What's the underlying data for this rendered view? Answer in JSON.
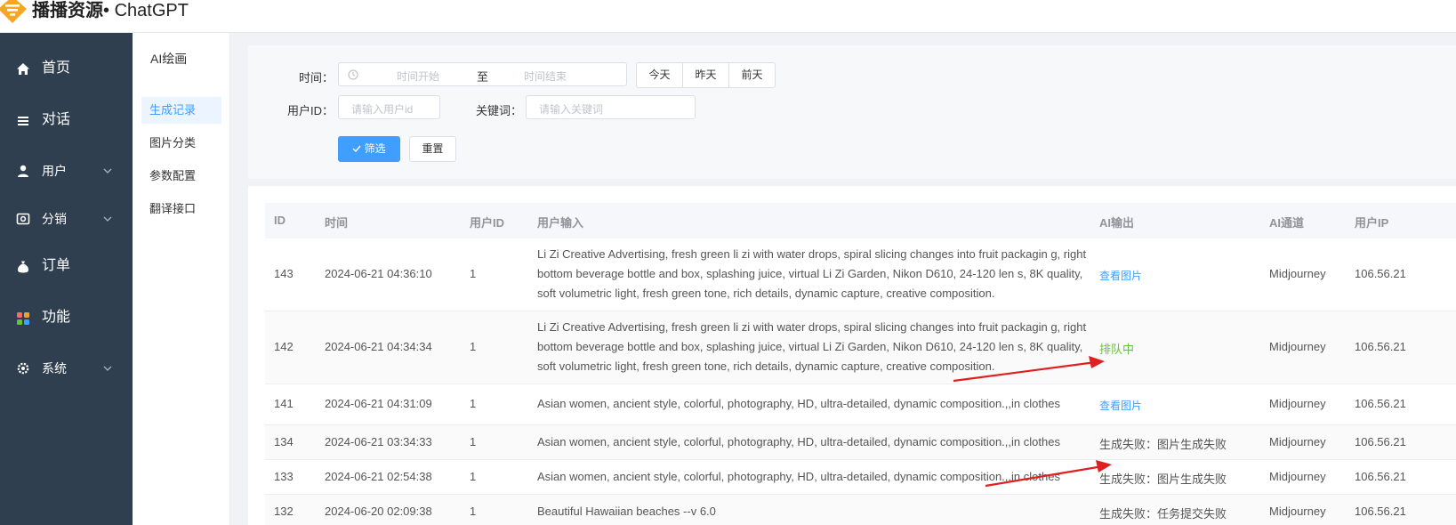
{
  "app": {
    "brand_cn": "播播资源",
    "brand_sep": "•",
    "brand_en": "ChatGPT"
  },
  "nav": {
    "items": [
      {
        "label": "首页",
        "icon": "home-icon"
      },
      {
        "label": "对话",
        "icon": "menu-icon"
      },
      {
        "label": "用户",
        "icon": "user-icon",
        "expandable": true
      },
      {
        "label": "分销",
        "icon": "distribution-icon",
        "expandable": true
      },
      {
        "label": "订单",
        "icon": "money-bag-icon"
      },
      {
        "label": "功能",
        "icon": "apps-grid-icon"
      },
      {
        "label": "系统",
        "icon": "gear-icon",
        "expandable": true
      }
    ]
  },
  "submenu": {
    "title": "AI绘画",
    "items": [
      "生成记录",
      "图片分类",
      "参数配置",
      "翻译接口"
    ],
    "active_index": 0
  },
  "filters": {
    "time_label": "时间：",
    "time_start_placeholder": "时间开始",
    "time_sep": "至",
    "time_end_placeholder": "时间结束",
    "quick_days": [
      "今天",
      "昨天",
      "前天"
    ],
    "user_id_label": "用户ID：",
    "user_id_placeholder": "请输入用户id",
    "keyword_label": "关键词：",
    "keyword_placeholder": "请输入关键词",
    "filter_button": "筛选",
    "reset_button": "重置"
  },
  "table": {
    "columns": [
      "ID",
      "时间",
      "用户ID",
      "用户输入",
      "AI输出",
      "AI通道",
      "用户IP"
    ],
    "rows": [
      {
        "id": "143",
        "time": "2024-06-21 04:36:10",
        "user_id": "1",
        "input": "Li Zi Creative Advertising, fresh green li zi with water drops, spiral slicing changes into fruit packagin g, right bottom beverage bottle and box, splashing juice, virtual Li Zi Garden, Nikon D610, 24-120 len s, 8K quality, soft volumetric light, fresh green tone, rich details, dynamic capture, creative composition.",
        "output": "查看图片",
        "output_type": "link",
        "channel": "Midjourney",
        "ip": "106.56.21"
      },
      {
        "id": "142",
        "time": "2024-06-21 04:34:34",
        "user_id": "1",
        "input": "Li Zi Creative Advertising, fresh green li zi with water drops, spiral slicing changes into fruit packagin g, right bottom beverage bottle and box, splashing juice, virtual Li Zi Garden, Nikon D610, 24-120 len s, 8K quality, soft volumetric light, fresh green tone, rich details, dynamic capture, creative composition.",
        "output": "排队中",
        "output_type": "queue",
        "channel": "Midjourney",
        "ip": "106.56.21"
      },
      {
        "id": "141",
        "time": "2024-06-21 04:31:09",
        "user_id": "1",
        "input": "Asian women, ancient style, colorful, photography, HD, ultra-detailed, dynamic composition.,,in clothes",
        "output": "查看图片",
        "output_type": "link",
        "channel": "Midjourney",
        "ip": "106.56.21"
      },
      {
        "id": "134",
        "time": "2024-06-21 03:34:33",
        "user_id": "1",
        "input": "Asian women, ancient style, colorful, photography, HD, ultra-detailed, dynamic composition.,,in clothes",
        "output": "生成失败：图片生成失败",
        "output_type": "text",
        "channel": "Midjourney",
        "ip": "106.56.21"
      },
      {
        "id": "133",
        "time": "2024-06-21 02:54:38",
        "user_id": "1",
        "input": "Asian women, ancient style, colorful, photography, HD, ultra-detailed, dynamic composition.,,in clothes",
        "output": "生成失败：图片生成失败",
        "output_type": "text",
        "channel": "Midjourney",
        "ip": "106.56.21"
      },
      {
        "id": "132",
        "time": "2024-06-20 02:09:38",
        "user_id": "1",
        "input": "Beautiful Hawaiian beaches --v 6.0",
        "output": "生成失败：任务提交失败",
        "output_type": "text",
        "channel": "Midjourney",
        "ip": "106.56.21"
      }
    ]
  },
  "colors": {
    "sidebar_bg": "#2f3f4f",
    "accent": "#409eff",
    "queue_green": "#67c23a",
    "annotation_red": "#e02020",
    "logo_orange": "#f5a623"
  }
}
